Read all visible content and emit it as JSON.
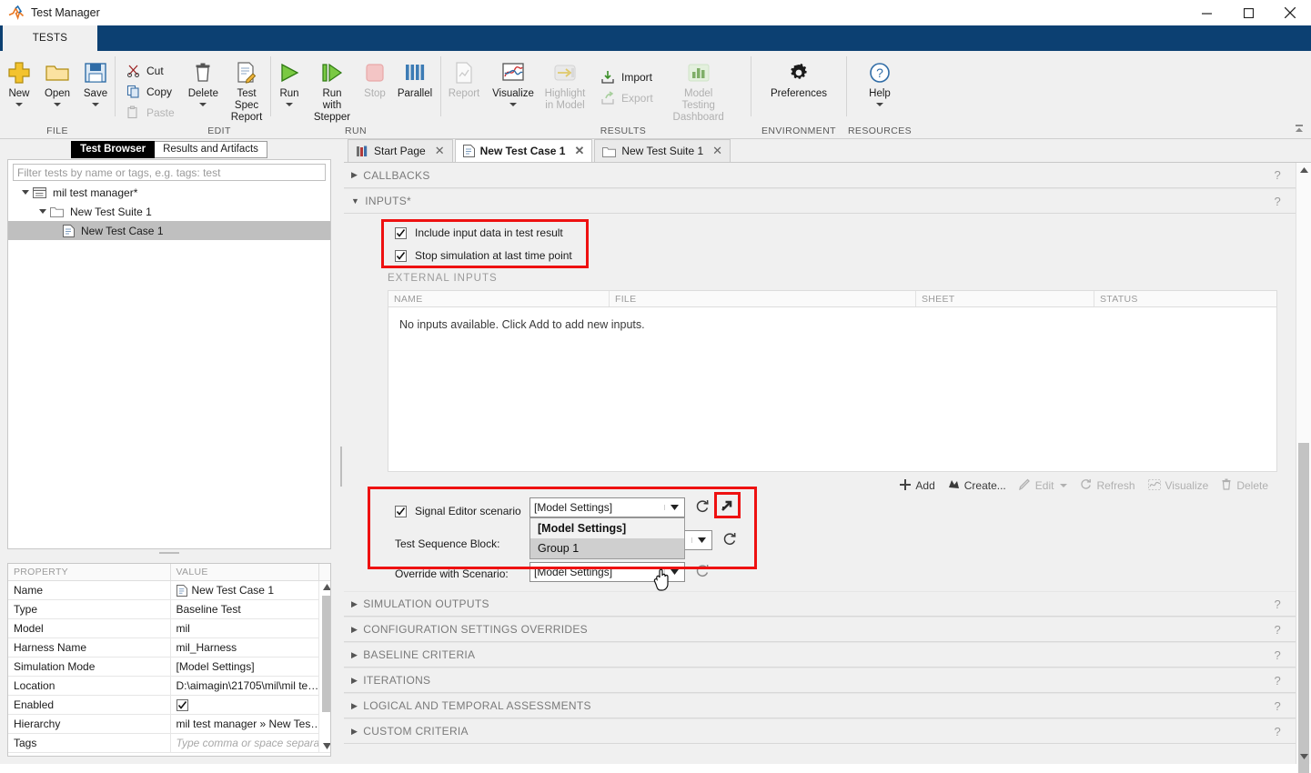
{
  "window": {
    "title": "Test Manager",
    "logo_icon": "matlab-logo-icon",
    "minimize_icon": "minimize-icon",
    "maximize_icon": "maximize-icon",
    "close_icon": "close-icon"
  },
  "ribbon": {
    "tab_label": "TESTS",
    "groups": [
      {
        "label": "FILE",
        "buttons": [
          {
            "label": "New",
            "icon": "new-plus-icon",
            "disabled": false,
            "has_caret": true
          },
          {
            "label": "Open",
            "icon": "open-folder-icon",
            "disabled": false,
            "has_caret": true
          },
          {
            "label": "Save",
            "icon": "save-disk-icon",
            "disabled": false,
            "has_caret": true
          }
        ]
      },
      {
        "label": "EDIT",
        "small_buttons": [
          {
            "label": "Cut",
            "icon": "scissors-icon",
            "disabled": false
          },
          {
            "label": "Copy",
            "icon": "copy-icon",
            "disabled": false
          },
          {
            "label": "Paste",
            "icon": "paste-icon",
            "disabled": true
          }
        ],
        "buttons": [
          {
            "label": "Delete",
            "icon": "trash-icon",
            "disabled": false,
            "has_caret": true
          },
          {
            "label": "Test Spec Report",
            "icon": "report-pencil-icon",
            "disabled": false,
            "has_caret": false
          }
        ]
      },
      {
        "label": "RUN",
        "buttons": [
          {
            "label": "Run",
            "icon": "play-icon",
            "disabled": false,
            "has_caret": true
          },
          {
            "label": "Run with Stepper",
            "icon": "play-step-icon",
            "disabled": false,
            "has_caret": false
          },
          {
            "label": "Stop",
            "icon": "stop-square-icon",
            "disabled": true,
            "has_caret": false
          },
          {
            "label": "Parallel",
            "icon": "parallel-bars-icon",
            "disabled": false,
            "has_caret": false
          }
        ]
      },
      {
        "label": "RESULTS",
        "buttons": [
          {
            "label": "Report",
            "icon": "report-icon",
            "disabled": true,
            "has_caret": false
          },
          {
            "label": "Visualize",
            "icon": "visualize-plot-icon",
            "disabled": false,
            "has_caret": true
          },
          {
            "label": "Highlight in Model",
            "icon": "highlight-model-icon",
            "disabled": true,
            "has_caret": false
          },
          {
            "label": "Model Testing Dashboard",
            "icon": "dashboard-bars-icon",
            "disabled": true,
            "has_caret": false
          }
        ],
        "small_buttons": [
          {
            "label": "Import",
            "icon": "import-arrow-icon",
            "disabled": false
          },
          {
            "label": "Export",
            "icon": "export-arrow-icon",
            "disabled": true
          }
        ]
      },
      {
        "label": "ENVIRONMENT",
        "buttons": [
          {
            "label": "Preferences",
            "icon": "gear-icon",
            "disabled": false,
            "has_caret": false
          }
        ]
      },
      {
        "label": "RESOURCES",
        "buttons": [
          {
            "label": "Help",
            "icon": "help-question-icon",
            "disabled": false,
            "has_caret": true
          }
        ]
      }
    ],
    "collapse_icon": "ribbon-collapse-icon"
  },
  "left_panel": {
    "tabs": [
      {
        "label": "Test Browser",
        "active": true
      },
      {
        "label": "Results and Artifacts",
        "active": false
      }
    ],
    "filter": {
      "placeholder": "Filter tests by name or tags, e.g. tags: test",
      "value": ""
    },
    "tree": [
      {
        "label": "mil test manager*",
        "level": 0,
        "icon": "test-file-icon",
        "expanded": true,
        "selected": false
      },
      {
        "label": "New Test Suite 1",
        "level": 1,
        "icon": "folder-icon",
        "expanded": true,
        "selected": false
      },
      {
        "label": "New Test Case 1",
        "level": 2,
        "icon": "testcase-icon",
        "expanded": null,
        "selected": true
      }
    ],
    "properties": {
      "headers": [
        "PROPERTY",
        "VALUE"
      ],
      "rows": [
        {
          "property": "Name",
          "value": "New Test Case 1",
          "icon": "testcase-icon",
          "editable": false
        },
        {
          "property": "Type",
          "value": "Baseline Test",
          "editable": false
        },
        {
          "property": "Model",
          "value": "mil",
          "editable": false
        },
        {
          "property": "Harness Name",
          "value": "mil_Harness",
          "editable": false
        },
        {
          "property": "Simulation Mode",
          "value": "[Model Settings]",
          "editable": false
        },
        {
          "property": "Location",
          "value": "D:\\aimagin\\21705\\mil\\mil te…",
          "editable": false
        },
        {
          "property": "Enabled",
          "value": "",
          "checkbox": true,
          "checked": true,
          "editable": true
        },
        {
          "property": "Hierarchy",
          "value": "mil test manager » New Tes…",
          "editable": false
        },
        {
          "property": "Tags",
          "value": "Type comma or space separat",
          "placeholder": true,
          "editable": true
        }
      ],
      "scroll_up_icon": "scroll-up-icon",
      "scroll_down_icon": "scroll-down-icon"
    }
  },
  "doc_tabs": [
    {
      "label": "Start Page",
      "icon": "start-page-icon",
      "active": false,
      "close_icon": "close-icon"
    },
    {
      "label": "New Test Case 1",
      "icon": "testcase-icon",
      "active": true,
      "close_icon": "close-icon"
    },
    {
      "label": "New Test Suite 1",
      "icon": "folder-icon",
      "active": false,
      "close_icon": "close-icon"
    }
  ],
  "main": {
    "sections_top": [
      {
        "label": "CALLBACKS",
        "expanded": false,
        "help_icon": "help-icon"
      },
      {
        "label": "INPUTS*",
        "expanded": true,
        "help_icon": "help-icon"
      }
    ],
    "inputs": {
      "checkboxes": [
        {
          "label": "Include input data in test result",
          "checked": true
        },
        {
          "label": "Stop simulation at last time point",
          "checked": true
        }
      ],
      "external_inputs_label": "EXTERNAL INPUTS",
      "table": {
        "headers": [
          "NAME",
          "FILE",
          "SHEET",
          "STATUS"
        ],
        "empty_message": "No inputs available. Click Add to add new inputs."
      },
      "toolbar": [
        {
          "label": "Add",
          "icon": "plus-icon",
          "disabled": false
        },
        {
          "label": "Create...",
          "icon": "create-icon",
          "disabled": false
        },
        {
          "label": "Edit",
          "icon": "pencil-icon",
          "disabled": true,
          "has_caret": true
        },
        {
          "label": "Refresh",
          "icon": "refresh-icon",
          "disabled": true
        },
        {
          "label": "Visualize",
          "icon": "visualize-icon",
          "disabled": true
        },
        {
          "label": "Delete",
          "icon": "trash-icon",
          "disabled": true
        }
      ],
      "scenario_rows": [
        {
          "checkbox_label": "Signal Editor scenario",
          "checked": true,
          "value": "[Model Settings]",
          "refresh_icon": "refresh-icon",
          "open_icon": "open-external-icon"
        },
        {
          "label": "Test Sequence Block:",
          "value": "",
          "refresh_icon": "refresh-icon"
        },
        {
          "label": "Override with Scenario:",
          "value": "[Model Settings]",
          "refresh_icon": "refresh-icon"
        }
      ],
      "dropdown": {
        "open": true,
        "options": [
          {
            "label": "[Model Settings]",
            "selected": true,
            "hover": false
          },
          {
            "label": "Group 1",
            "selected": false,
            "hover": true
          }
        ]
      }
    },
    "sections_bottom": [
      {
        "label": "SIMULATION OUTPUTS",
        "expanded": false,
        "help_icon": "help-icon"
      },
      {
        "label": "CONFIGURATION SETTINGS OVERRIDES",
        "expanded": false,
        "help_icon": "help-icon"
      },
      {
        "label": "BASELINE CRITERIA",
        "expanded": false,
        "help_icon": "help-icon"
      },
      {
        "label": "ITERATIONS",
        "expanded": false,
        "help_icon": "help-icon"
      },
      {
        "label": "LOGICAL AND TEMPORAL ASSESSMENTS",
        "expanded": false,
        "help_icon": "help-icon"
      },
      {
        "label": "CUSTOM CRITERIA",
        "expanded": false,
        "help_icon": "help-icon"
      }
    ]
  },
  "colors": {
    "ribbon_tab_bg": "#0c4072",
    "highlight_red": "#ee1111",
    "panel_bg": "#f0f0f0",
    "selection_gray": "#bfbfbf"
  }
}
